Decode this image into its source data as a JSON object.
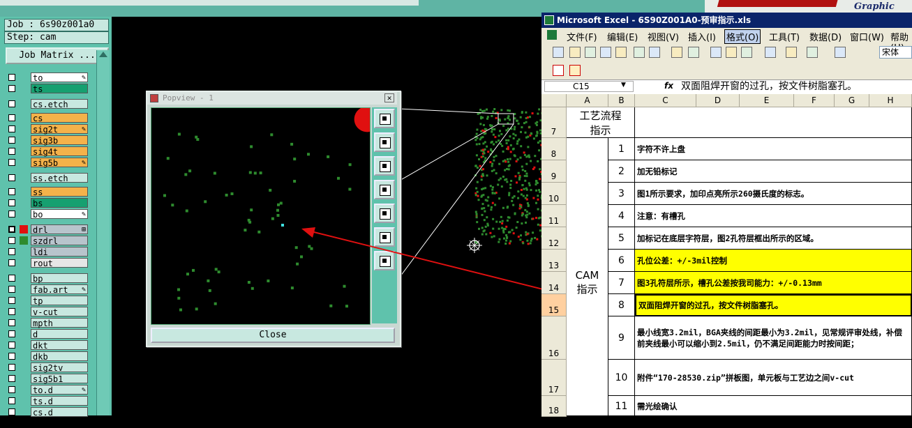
{
  "app": {
    "graphic_editor_label": "Graphic Editor"
  },
  "job_panel": {
    "job_label": "Job : 6s90z001a0",
    "step_label": "Step: cam",
    "job_matrix_button": "Job Matrix ..."
  },
  "layers": [
    {
      "name": "to",
      "color": "#ffffff",
      "mark": "✎"
    },
    {
      "name": "ts",
      "color": "#16a070",
      "mark": ""
    },
    {
      "name": "cs.etch",
      "color": "#c8e8e0",
      "mark": ""
    },
    {
      "name": "cs",
      "color": "#f4b24a",
      "mark": ""
    },
    {
      "name": "sig2t",
      "color": "#f4b24a",
      "mark": "✎"
    },
    {
      "name": "sig3b",
      "color": "#f4b24a",
      "mark": ""
    },
    {
      "name": "sig4t",
      "color": "#f4b24a",
      "mark": ""
    },
    {
      "name": "sig5b",
      "color": "#f4b24a",
      "mark": "✎"
    },
    {
      "name": "ss.etch",
      "color": "#c8e8e0",
      "mark": ""
    },
    {
      "name": "ss",
      "color": "#f4b24a",
      "mark": ""
    },
    {
      "name": "bs",
      "color": "#16a070",
      "mark": ""
    },
    {
      "name": "bo",
      "color": "#ffffff",
      "mark": "✎"
    },
    {
      "name": "drl",
      "color": "#b8c4cc",
      "mark": "⊞"
    },
    {
      "name": "szdrl",
      "color": "#b8c4cc",
      "mark": ""
    },
    {
      "name": "ldi",
      "color": "#b8c4cc",
      "mark": ""
    },
    {
      "name": "rout",
      "color": "#e6e6e6",
      "mark": ""
    },
    {
      "name": "bp",
      "color": "#c8e8e0",
      "mark": ""
    },
    {
      "name": "fab.art",
      "color": "#c8e8e0",
      "mark": "✎"
    },
    {
      "name": "tp",
      "color": "#c8e8e0",
      "mark": ""
    },
    {
      "name": "v-cut",
      "color": "#c8e8e0",
      "mark": ""
    },
    {
      "name": "mpth",
      "color": "#c8e8e0",
      "mark": ""
    },
    {
      "name": "d",
      "color": "#c8e8e0",
      "mark": ""
    },
    {
      "name": "dkt",
      "color": "#c8e8e0",
      "mark": ""
    },
    {
      "name": "dkb",
      "color": "#c8e8e0",
      "mark": ""
    },
    {
      "name": "sig2tv",
      "color": "#c8e8e0",
      "mark": ""
    },
    {
      "name": "sig5b1",
      "color": "#c8e8e0",
      "mark": ""
    },
    {
      "name": "to.d",
      "color": "#c8e8e0",
      "mark": "✎"
    },
    {
      "name": "ts.d",
      "color": "#c8e8e0",
      "mark": ""
    },
    {
      "name": "cs.d",
      "color": "#c8e8e0",
      "mark": ""
    }
  ],
  "popview": {
    "title": "Popview - 1",
    "close_label": "Close",
    "tools": [
      "zoom-fit-icon",
      "pan-up-icon",
      "pan-down-icon",
      "pan-left-icon",
      "pan-right-icon",
      "zoom-out-icon",
      "zoom-in-icon"
    ]
  },
  "excel": {
    "title": "Microsoft Excel - 6S90Z001A0-预审指示.xls",
    "menu": [
      "文件(F)",
      "编辑(E)",
      "视图(V)",
      "插入(I)",
      "格式(O)",
      "工具(T)",
      "数据(D)",
      "窗口(W)",
      "帮助(H)"
    ],
    "font_name": "宋体",
    "name_box": "C15",
    "fx_label": "fx",
    "formula": "双面阻焊开窗的过孔，按文件树脂塞孔。",
    "columns": [
      "A",
      "B",
      "C",
      "D",
      "E",
      "F",
      "G",
      "H"
    ],
    "section_a7": "工艺流程指示",
    "section_cam": "CAM指示",
    "rows": [
      {
        "row": "7",
        "no": "",
        "text": "",
        "highlight": false
      },
      {
        "row": "8",
        "no": "1",
        "text": "字符不许上盘",
        "highlight": false
      },
      {
        "row": "9",
        "no": "2",
        "text": "加无铅标记",
        "highlight": false
      },
      {
        "row": "10",
        "no": "3",
        "text": "图1所示要求，加印点亮所示260摄氏度的标志。",
        "highlight": false
      },
      {
        "row": "11",
        "no": "4",
        "text": "注意：有槽孔",
        "highlight": false
      },
      {
        "row": "12",
        "no": "5",
        "text": "加标记在底层字符层，图2孔符层框出所示的区域。",
        "highlight": false
      },
      {
        "row": "13",
        "no": "6",
        "text": "孔位公差：+/-3mil控制",
        "highlight": true
      },
      {
        "row": "14",
        "no": "7",
        "text": "图3孔符层所示，槽孔公差按我司能力：+/-0.13mm",
        "highlight": true
      },
      {
        "row": "15",
        "no": "8",
        "text": "双面阻焊开窗的过孔，按文件树脂塞孔。",
        "highlight": true
      },
      {
        "row": "16",
        "no": "9",
        "text": "最小线宽3.2mil，BGA夹线的间距最小为3.2mil，见常规评审处线，补偿前夹线最小可以缩小到2.5mil，仍不满足间距能力时按间距；",
        "highlight": false
      },
      {
        "row": "17",
        "no": "10",
        "text": "附件“170-28530.zip”拼板图，单元板与工艺边之间v-cut",
        "highlight": false
      },
      {
        "row": "18",
        "no": "11",
        "text": "需光绘确认",
        "highlight": false
      }
    ]
  },
  "colors": {
    "panel_teal": "#5fc2ac",
    "pad_green": "#2e8b2e",
    "arrow_red": "#e01010",
    "highlight_yellow": "#ffff00",
    "excel_title_blue": "#0a246a"
  }
}
